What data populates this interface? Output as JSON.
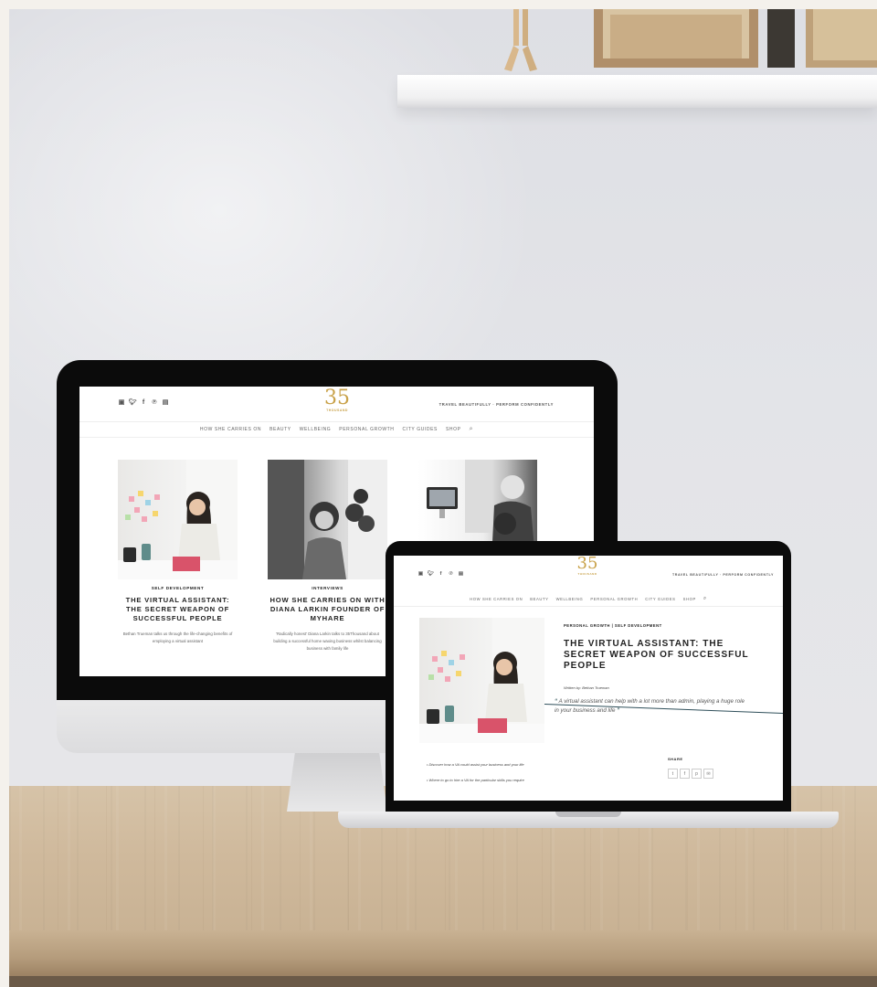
{
  "imac_site": {
    "social_icons": [
      "instagram-icon",
      "twitter-icon",
      "facebook-icon",
      "pinterest-icon",
      "linkedin-icon"
    ],
    "logo": {
      "number": "35",
      "subtitle": "THOUSAND"
    },
    "tagline": "TRAVEL BEAUTIFULLY · PERFORM CONFIDENTLY",
    "nav": [
      "HOW SHE CARRIES ON",
      "BEAUTY",
      "WELLBEING",
      "PERSONAL GROWTH",
      "CITY GUIDES",
      "SHOP"
    ],
    "cards": [
      {
        "category": "SELF DEVELOPMENT",
        "title": "THE VIRTUAL ASSISTANT: THE SECRET WEAPON OF SUCCESSFUL PEOPLE",
        "excerpt": "Bethan Trueman talks us through the life-changing benefits of employing a virtual assistant"
      },
      {
        "category": "INTERVIEWS",
        "title": "HOW SHE CARRIES ON WITH DIANA LARKIN FOUNDER OF MYHARE",
        "excerpt": "'Radically honest' Diana Larkin talks to 35Thousand about building a successful home waxing business whilst balancing business with family life"
      },
      {
        "category": "",
        "title": "",
        "excerpt": ""
      }
    ]
  },
  "laptop_site": {
    "social_icons": [
      "instagram-icon",
      "twitter-icon",
      "facebook-icon",
      "pinterest-icon",
      "linkedin-icon"
    ],
    "logo": {
      "number": "35",
      "subtitle": "THOUSAND"
    },
    "tagline": "TRAVEL BEAUTIFULLY · PERFORM CONFIDENTLY",
    "nav": [
      "HOW SHE CARRIES ON",
      "BEAUTY",
      "WELLBEING",
      "PERSONAL GROWTH",
      "CITY GUIDES",
      "SHOP"
    ],
    "article": {
      "categories": "PERSONAL GROWTH   |   SELF DEVELOPMENT",
      "title": "THE VIRTUAL ASSISTANT: THE SECRET WEAPON OF SUCCESSFUL PEOPLE",
      "author": "Written by: Bethan Trueman",
      "quote": "A virtual assistant can help with a lot more than admin, playing a huge role in your business and life"
    },
    "bullets": [
      "Discover how a VA could assist your business and your life",
      "Where to go to hire a VA for the particular skills you require"
    ],
    "share": {
      "label": "SHARE",
      "icons": [
        "twitter-icon",
        "facebook-icon",
        "pinterest-icon",
        "email-icon"
      ]
    }
  },
  "colors": {
    "accent_gold": "#c9a24a",
    "line_teal": "#2f4f5a"
  }
}
